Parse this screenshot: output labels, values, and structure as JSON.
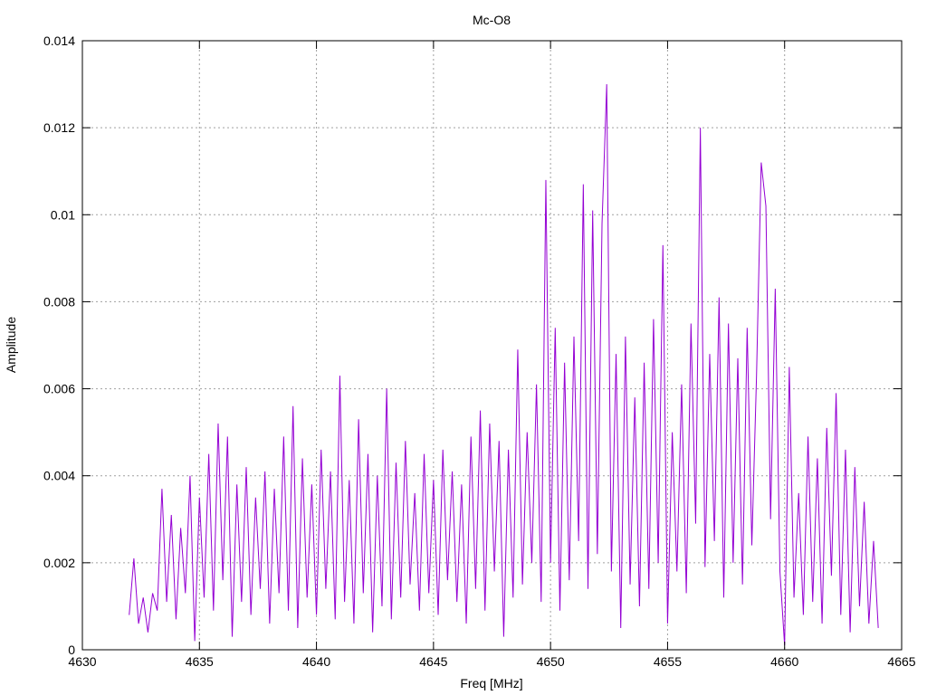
{
  "chart_data": {
    "type": "line",
    "title": "Mc-O8",
    "xlabel": "Freq [MHz]",
    "ylabel": "Amplitude",
    "xlim": [
      4630,
      4665
    ],
    "ylim": [
      0,
      0.014
    ],
    "xticks": [
      "4630",
      "4635",
      "4640",
      "4645",
      "4650",
      "4655",
      "4660",
      "4665"
    ],
    "yticks": [
      "0",
      "0.002",
      "0.004",
      "0.006",
      "0.008",
      "0.01",
      "0.012",
      "0.014"
    ],
    "grid": true,
    "series": [
      {
        "name": "Mc-O8",
        "color": "#9400d3",
        "x_start": 4632,
        "x_step": 0.2,
        "values": [
          0.0008,
          0.0021,
          0.0006,
          0.0012,
          0.0004,
          0.0013,
          0.0009,
          0.0037,
          0.0011,
          0.0031,
          0.0007,
          0.0028,
          0.0013,
          0.004,
          0.0002,
          0.0035,
          0.0012,
          0.0045,
          0.0009,
          0.0052,
          0.0016,
          0.0049,
          0.0003,
          0.0038,
          0.0011,
          0.0042,
          0.0008,
          0.0035,
          0.0014,
          0.0041,
          0.0006,
          0.0037,
          0.0013,
          0.0049,
          0.0009,
          0.0056,
          0.0005,
          0.0044,
          0.0012,
          0.0038,
          0.0008,
          0.0046,
          0.0014,
          0.0041,
          0.0007,
          0.0063,
          0.0011,
          0.0039,
          0.0006,
          0.0053,
          0.0013,
          0.0045,
          0.0004,
          0.004,
          0.001,
          0.006,
          0.0007,
          0.0043,
          0.0012,
          0.0048,
          0.0015,
          0.0036,
          0.0009,
          0.0045,
          0.0013,
          0.0039,
          0.0008,
          0.0046,
          0.0016,
          0.0041,
          0.0011,
          0.0038,
          0.0006,
          0.0049,
          0.0014,
          0.0055,
          0.0009,
          0.0052,
          0.0018,
          0.0048,
          0.0003,
          0.0046,
          0.0012,
          0.0069,
          0.0015,
          0.005,
          0.002,
          0.0061,
          0.0011,
          0.0108,
          0.002,
          0.0074,
          0.0009,
          0.0066,
          0.0016,
          0.0072,
          0.0025,
          0.0107,
          0.0014,
          0.0101,
          0.0022,
          0.0098,
          0.013,
          0.0018,
          0.0068,
          0.0005,
          0.0072,
          0.0015,
          0.0058,
          0.001,
          0.0066,
          0.0014,
          0.0076,
          0.002,
          0.0093,
          0.0006,
          0.005,
          0.0018,
          0.0061,
          0.0013,
          0.0075,
          0.0029,
          0.012,
          0.0019,
          0.0068,
          0.0025,
          0.0081,
          0.0012,
          0.0075,
          0.002,
          0.0067,
          0.0015,
          0.0074,
          0.0024,
          0.0063,
          0.0112,
          0.0102,
          0.003,
          0.0083,
          0.0018,
          0.0001,
          0.0065,
          0.0012,
          0.0036,
          0.0008,
          0.0049,
          0.0011,
          0.0044,
          0.0006,
          0.0051,
          0.0017,
          0.0059,
          0.0008,
          0.0046,
          0.0004,
          0.0042,
          0.001,
          0.0034,
          0.0006,
          0.0025,
          0.0005
        ]
      }
    ]
  }
}
